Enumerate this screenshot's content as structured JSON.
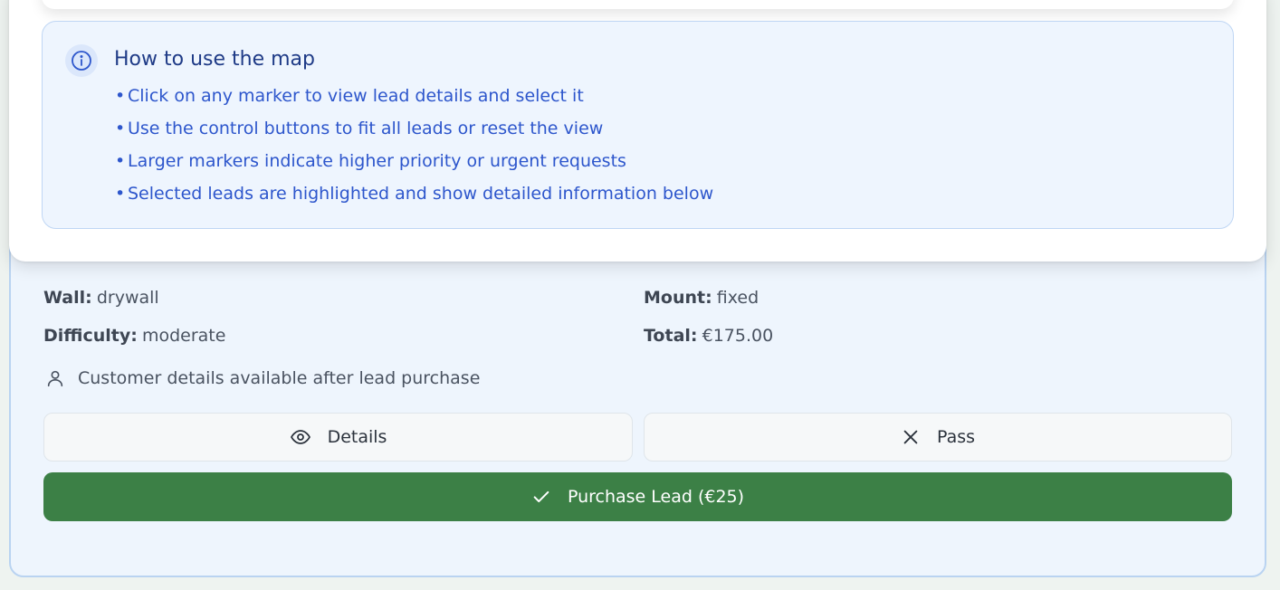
{
  "how_to": {
    "title": "How to use the map",
    "tips": [
      "Click on any marker to view lead details and select it",
      "Use the control buttons to fit all leads or reset the view",
      "Larger markers indicate higher priority or urgent requests",
      "Selected leads are highlighted and show detailed information below"
    ],
    "bullet": "•",
    "icon": "info-icon"
  },
  "lead": {
    "wall_label": "Wall:",
    "wall_value": "drywall",
    "mount_label": "Mount:",
    "mount_value": "fixed",
    "difficulty_label": "Difficulty:",
    "difficulty_value": "moderate",
    "total_label": "Total:",
    "total_value": "€175.00",
    "customer_note": "Customer details available after lead purchase",
    "customer_icon": "user-icon"
  },
  "actions": {
    "details_label": "Details",
    "pass_label": "Pass",
    "purchase_label": "Purchase Lead (€25)",
    "details_icon": "eye-icon",
    "pass_icon": "close-icon",
    "purchase_icon": "check-icon"
  },
  "colors": {
    "primary_green": "#3c8046",
    "info_blue": "#2d56cc",
    "info_title": "#1f3b87",
    "card_bg": "#eef5fd"
  }
}
